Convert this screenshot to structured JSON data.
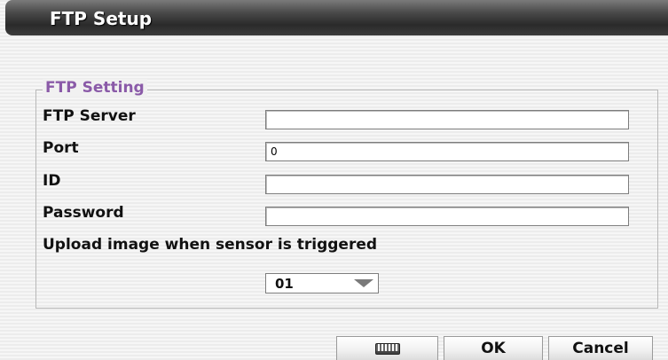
{
  "window": {
    "title": "FTP Setup"
  },
  "group": {
    "legend": "FTP Setting"
  },
  "fields": {
    "ftp_server": {
      "label": "FTP Server",
      "value": ""
    },
    "port": {
      "label": "Port",
      "value": "0"
    },
    "id": {
      "label": "ID",
      "value": ""
    },
    "password": {
      "label": "Password",
      "value": ""
    }
  },
  "sensor": {
    "label": "Upload image when sensor is triggered",
    "selected": "01"
  },
  "buttons": {
    "keyboard_icon": "keyboard-icon",
    "ok": "OK",
    "cancel": "Cancel"
  }
}
